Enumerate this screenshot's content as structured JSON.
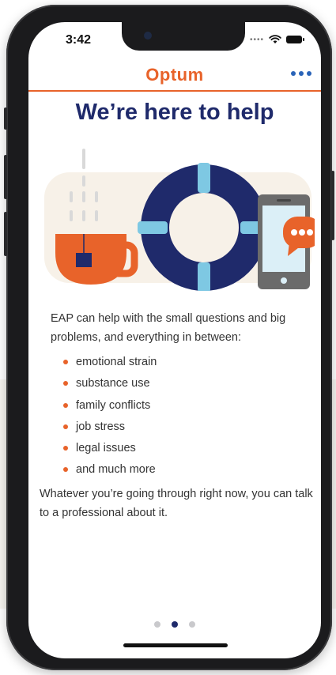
{
  "status_bar": {
    "time": "3:42",
    "icons": [
      "signal-dots-icon",
      "wifi-icon",
      "battery-icon"
    ]
  },
  "header": {
    "brand": "Optum",
    "menu_icon": "more-horizontal-icon"
  },
  "page": {
    "title": "We’re here to help",
    "hero_icons": [
      "tea-cup-icon",
      "life-ring-icon",
      "smartphone-icon",
      "chat-bubble-icon"
    ],
    "intro": "EAP can help with the small questions and big problems, and everything in between:",
    "bullets": [
      "emotional strain",
      "substance use",
      "family conflicts",
      "job stress",
      "legal issues",
      "and much more"
    ],
    "closing": "Whatever you’re going through right now, you can talk to a professional about it."
  },
  "pager": {
    "total": 3,
    "active_index": 1
  },
  "colors": {
    "brand_orange": "#e8632a",
    "navy": "#1f2a6b",
    "light_blue": "#7ec8e3",
    "link_blue": "#2a64b8"
  }
}
